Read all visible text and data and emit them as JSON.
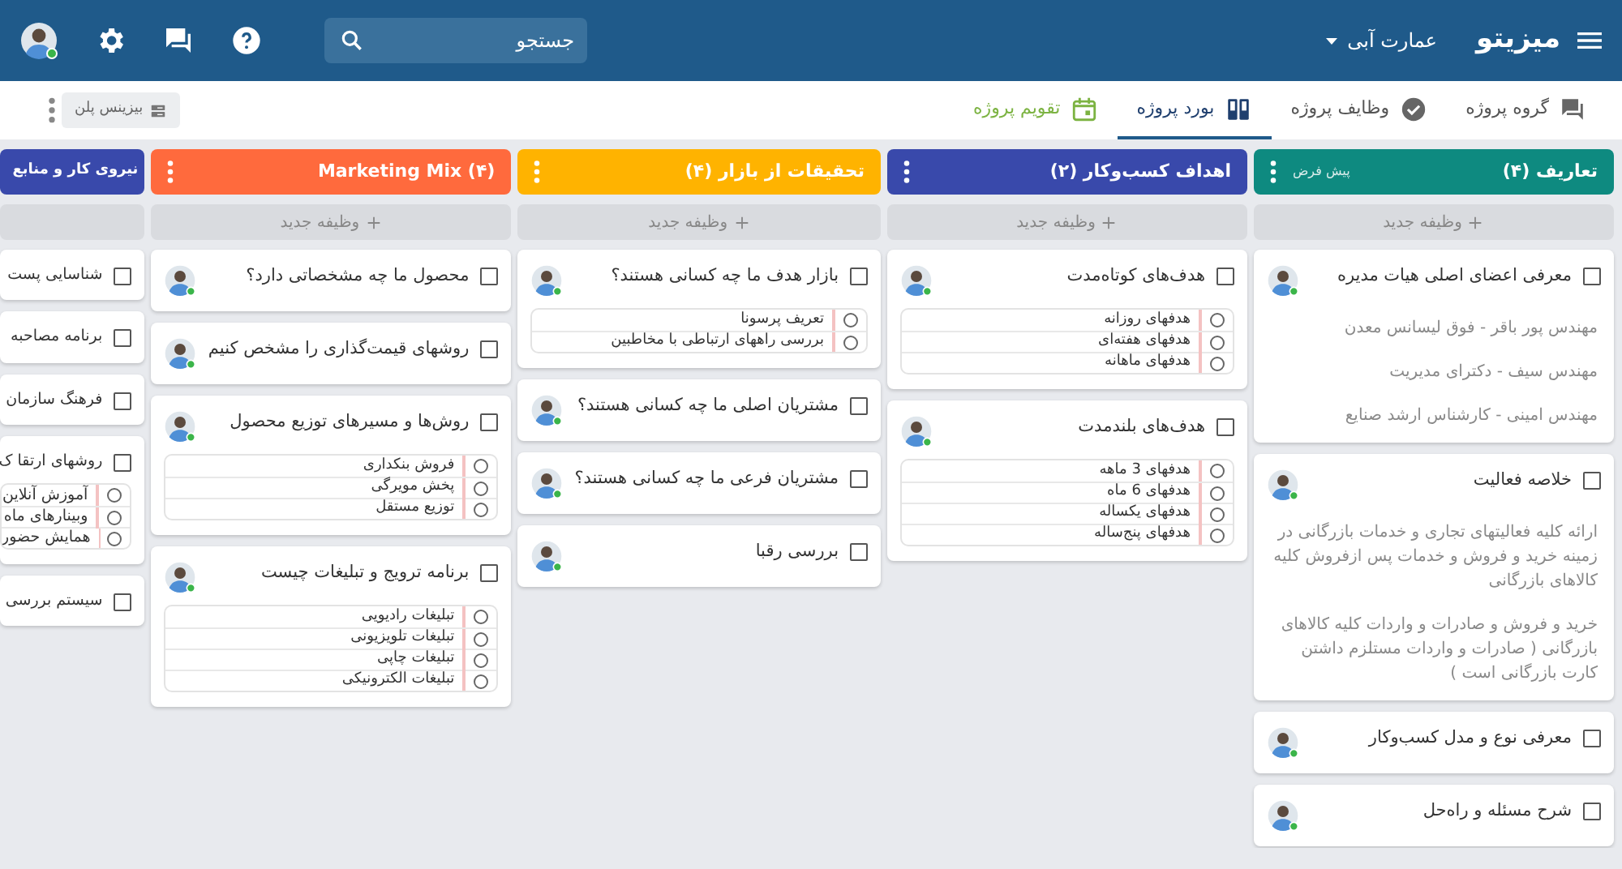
{
  "app": {
    "logo": "میزیتو",
    "workspace": "عمارت آبی",
    "search": {
      "placeholder": "جستجو"
    }
  },
  "tabs": [
    {
      "label": "گروه پروژه",
      "selected": false,
      "kind": "group"
    },
    {
      "label": "وظایف پروژه",
      "selected": false,
      "kind": "tasks"
    },
    {
      "label": "بورد پروژه",
      "selected": true,
      "kind": "board"
    },
    {
      "label": "تقویم پروژه",
      "selected": false,
      "kind": "calendar"
    }
  ],
  "plan_chip": "بیزینس پلن",
  "columns": [
    {
      "title": "تعاریف (۴)",
      "badge": "پیش فرض",
      "color": "#0e8a80",
      "add_label": "وظیفه جدید",
      "cards": [
        {
          "title": "معرفی اعضای اصلی هیات مدیره",
          "checked": false,
          "notes": [
            "مهندس پور باقر - فوق لیسانس معدن",
            "مهندس سیف - دکترای مدیریت",
            "مهندس امینی - کارشناس ارشد صنایع"
          ]
        },
        {
          "title": "خلاصه فعالیت",
          "checked": false,
          "notes": [
            "ارائه کلیه فعالیتهای تجاری و خدمات بازرگانی در زمینه خرید و فروش و خدمات پس ازفروش کلیه کالاهای بازرگانی",
            "خرید و فروش و صادرات و واردات کلیه کالاهای بازرگانی ( صادرات و واردات مستلزم داشتن کارت بازرگانی است )"
          ]
        },
        {
          "title": "معرفی نوع و مدل کسب‌وکار",
          "checked": false
        },
        {
          "title": "شرح مسئله و راه‌حل",
          "checked": false
        }
      ]
    },
    {
      "title": "اهداف کسب‌وکار (۲)",
      "color": "#3949ab",
      "add_label": "وظیفه جدید",
      "cards": [
        {
          "title": "هدف‌های کوتاه‌مدت",
          "checked": false,
          "subtasks": [
            {
              "label": "هدفهای روزانه",
              "done": false
            },
            {
              "label": "هدفهای هفته‌ای",
              "done": false
            },
            {
              "label": "هدفهای ماهانه",
              "done": false
            }
          ]
        },
        {
          "title": "هدف‌های بلندمدت",
          "checked": false,
          "subtasks": [
            {
              "label": "هدفهای 3 ماهه",
              "done": false
            },
            {
              "label": "هدفهای 6 ماه",
              "done": false
            },
            {
              "label": "هدفهای یکساله",
              "done": false
            },
            {
              "label": "هدفهای پنج‌ساله",
              "done": false
            }
          ]
        }
      ]
    },
    {
      "title": "تحقیقات از بازار (۴)",
      "color": "#ffb300",
      "add_label": "وظیفه جدید",
      "cards": [
        {
          "title": "بازار هدف ما چه کسانی هستند؟",
          "checked": false,
          "subtasks": [
            {
              "label": "تعریف پرسونا",
              "done": false
            },
            {
              "label": "بررسی راههای ارتباطی با مخاطبین",
              "done": false
            }
          ]
        },
        {
          "title": "مشتریان اصلی ما چه کسانی هستند؟",
          "checked": false
        },
        {
          "title": "مشتریان فرعی ما چه کسانی هستند؟",
          "checked": false
        },
        {
          "title": "بررسی رقبا",
          "checked": false
        }
      ]
    },
    {
      "title": "Marketing Mix (۴)",
      "color": "#ff6a3d",
      "add_label": "وظیفه جدید",
      "cards": [
        {
          "title": "محصول ما چه مشخصاتی دارد؟",
          "checked": false
        },
        {
          "title": "روشهای قیمت‌گذاری را مشخص کنیم",
          "checked": false
        },
        {
          "title": "روش‌ها و مسیرهای توزیع محصول",
          "checked": false,
          "subtasks": [
            {
              "label": "فروش بنکداری",
              "done": false
            },
            {
              "label": "پخش مویرگی",
              "done": false
            },
            {
              "label": "توزیع مستقل",
              "done": false
            }
          ]
        },
        {
          "title": "برنامه ترویج و تبلیغات چیست",
          "checked": false,
          "subtasks": [
            {
              "label": "تبلیغات رادیویی",
              "done": false
            },
            {
              "label": "تبلیغات تلویزیونی",
              "done": false
            },
            {
              "label": "تبلیغات چاپی",
              "done": false
            },
            {
              "label": "تبلیغات الکترونیکی",
              "done": false
            }
          ]
        }
      ]
    },
    {
      "title": "نیروی کار و منابع",
      "color": "#3949ab",
      "cut": true,
      "cards": [
        {
          "title": "شناسایی پست",
          "checked": false
        },
        {
          "title": "برنامه مصاحبه",
          "checked": false
        },
        {
          "title": "فرهنگ سازمان",
          "checked": false
        },
        {
          "title": "روشهای ارتقا ک",
          "checked": false,
          "subtasks": [
            {
              "label": "آموزش آنلاین",
              "done": false
            },
            {
              "label": "وبینارهای ماه",
              "done": false
            },
            {
              "label": "همایش حضور",
              "done": false
            }
          ]
        },
        {
          "title": "سیستم بررسی",
          "checked": false
        }
      ]
    }
  ]
}
